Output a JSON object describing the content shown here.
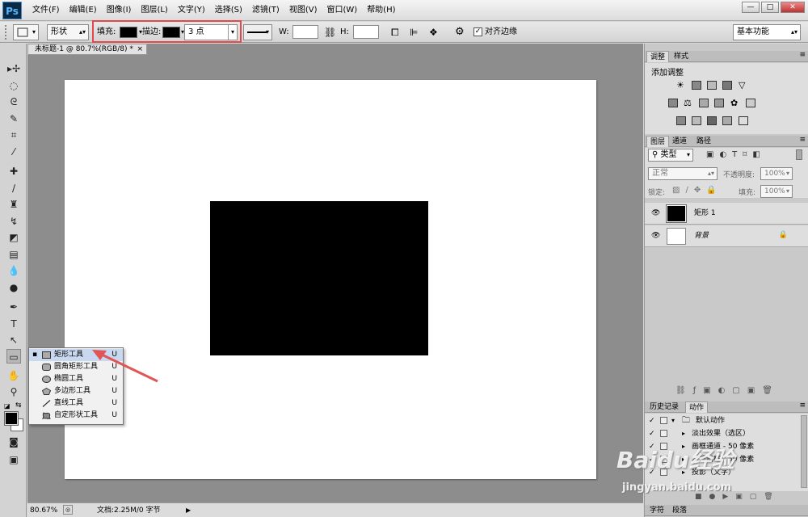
{
  "app": {
    "logo": "Ps",
    "menus": [
      "文件(F)",
      "编辑(E)",
      "图像(I)",
      "图层(L)",
      "文字(Y)",
      "选择(S)",
      "滤镜(T)",
      "视图(V)",
      "窗口(W)",
      "帮助(H)"
    ],
    "window_controls": {
      "minimize": "—",
      "maximize": "□",
      "close": "✕"
    }
  },
  "options_bar": {
    "mode": "形状",
    "fill_label": "填充:",
    "stroke_label": "描边:",
    "stroke_width": "3 点",
    "w_label": "W:",
    "h_label": "H:",
    "align_edges": "对齐边缘",
    "workspace": "基本功能",
    "fill_color": "#000000",
    "stroke_color": "#000000"
  },
  "document": {
    "tab_title": "未标题-1 @ 80.7%(RGB/8) *",
    "close": "×",
    "shape_color": "#000000"
  },
  "status": {
    "zoom": "80.67%",
    "doc_info": "文档:2.25M/0 字节"
  },
  "flyout": {
    "items": [
      {
        "label": "矩形工具",
        "key": "U"
      },
      {
        "label": "圆角矩形工具",
        "key": "U"
      },
      {
        "label": "椭圆工具",
        "key": "U"
      },
      {
        "label": "多边形工具",
        "key": "U"
      },
      {
        "label": "直线工具",
        "key": "U"
      },
      {
        "label": "自定形状工具",
        "key": "U"
      }
    ]
  },
  "panels": {
    "adjust_tabs": [
      "调整",
      "样式"
    ],
    "adjust_heading": "添加调整",
    "layers_tabs": [
      "图层",
      "通道",
      "路径"
    ],
    "filter_kind": "类型",
    "blend_mode": "正常",
    "opacity_label": "不透明度:",
    "opacity_value": "100%",
    "lock_label": "锁定:",
    "fill_label": "填充:",
    "fill_value": "100%",
    "layers": [
      {
        "name": "矩形 1"
      },
      {
        "name": "背景"
      }
    ],
    "history_tabs": [
      "历史记录",
      "动作"
    ],
    "actions": [
      {
        "name": "默认动作"
      },
      {
        "name": "淡出效果（选区）"
      },
      {
        "name": "画框通道 - 50 像素"
      },
      {
        "name": "木质画框 - 50 像素"
      },
      {
        "name": "投影（文字）"
      }
    ],
    "char_tabs": [
      "字符",
      "段落"
    ]
  },
  "watermark": {
    "brand": "Baidu经验",
    "url": "jingyan.baidu.com"
  }
}
